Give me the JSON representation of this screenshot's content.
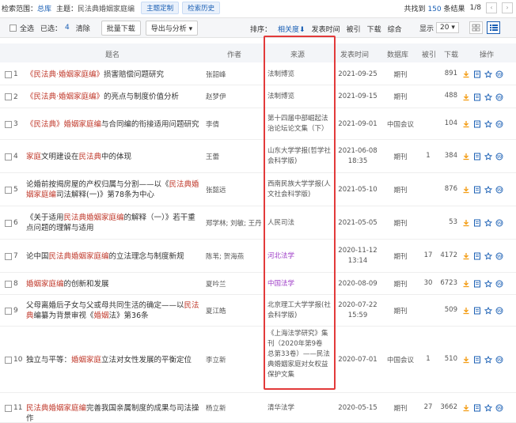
{
  "topbar": {
    "scope_label": "检索范围：",
    "scope_value": "总库",
    "theme_label": "主题：",
    "theme_value": "民法典婚姻家庭编",
    "btn_custom": "主题定制",
    "btn_history": "检索历史",
    "total_prefix": "共找到",
    "total_count": "150",
    "total_suffix": "条结果",
    "page": "1/8"
  },
  "toolbar": {
    "select_all": "全选",
    "selected_label": "已选：",
    "selected_count": "4",
    "clear": "清除",
    "batch_download": "批量下载",
    "export": "导出与分析 ▾",
    "sort_label": "排序：",
    "sort_relevance": "相关度⬇",
    "sort_date": "发表时间",
    "sort_cited": "被引",
    "sort_download": "下载",
    "sort_overall": "综合",
    "display_label": "显示",
    "display_value": "20 ▾"
  },
  "columns": {
    "title": "题名",
    "author": "作者",
    "source": "来源",
    "date": "发表时间",
    "db": "数据库",
    "cited": "被引",
    "download": "下载",
    "ops": "操作"
  },
  "rows": [
    {
      "num": "1",
      "title_parts": [
        {
          "t": "《民法典·婚姻家庭编》",
          "hl": true
        },
        {
          "t": "损害赔偿问题研究",
          "hl": false
        }
      ],
      "author": "张韶峰",
      "source": "法制博览",
      "date": "2021-09-25",
      "db": "期刊",
      "cited": "",
      "download": "891",
      "purple": false
    },
    {
      "num": "2",
      "title_parts": [
        {
          "t": "《民法典·婚姻家庭编》",
          "hl": true
        },
        {
          "t": "的亮点与制度价值分析",
          "hl": false
        }
      ],
      "author": "赵梦伊",
      "source": "法制博览",
      "date": "2021-09-15",
      "db": "期刊",
      "cited": "",
      "download": "488",
      "purple": false
    },
    {
      "num": "3",
      "title_parts": [
        {
          "t": "《民法典》",
          "hl": true
        },
        {
          "t": "婚姻家庭编",
          "hl": true
        },
        {
          "t": "与合同编的衔接适用问题研究",
          "hl": false
        }
      ],
      "author": "李倩",
      "source": "第十四届中部崛起法治论坛论文集（下）",
      "date": "2021-09-01",
      "db": "中国会议",
      "cited": "",
      "download": "104",
      "purple": false
    },
    {
      "num": "4",
      "title_parts": [
        {
          "t": "家庭",
          "hl": true
        },
        {
          "t": "文明建设在",
          "hl": false
        },
        {
          "t": "民法典",
          "hl": true
        },
        {
          "t": "中的体现",
          "hl": false
        }
      ],
      "author": "王蕾",
      "source": "山东大学学报(哲学社会科学版)",
      "date": "2021-06-08 18:35",
      "db": "期刊",
      "cited": "1",
      "download": "384",
      "purple": false
    },
    {
      "num": "5",
      "title_parts": [
        {
          "t": "论婚前按揭房屋的产权归属与分割——以《",
          "hl": false
        },
        {
          "t": "民法典婚姻家庭编",
          "hl": true
        },
        {
          "t": "司法解释(一)》第78条为中心",
          "hl": false
        }
      ],
      "author": "张懿远",
      "source": "西南民族大学学报(人文社会科学版)",
      "date": "2021-05-10",
      "db": "期刊",
      "cited": "",
      "download": "876",
      "purple": false
    },
    {
      "num": "6",
      "title_parts": [
        {
          "t": "《关于适用",
          "hl": false
        },
        {
          "t": "民法典婚姻家庭编",
          "hl": true
        },
        {
          "t": "的解释（一）》若干重点问题的理解与适用",
          "hl": false
        }
      ],
      "author": "郑学林; 刘敏; 王丹",
      "source": "人民司法",
      "date": "2021-05-05",
      "db": "期刊",
      "cited": "",
      "download": "53",
      "purple": false
    },
    {
      "num": "7",
      "title_parts": [
        {
          "t": "论中国",
          "hl": false
        },
        {
          "t": "民法典婚姻家庭编",
          "hl": true
        },
        {
          "t": "的立法理念与制度新规",
          "hl": false
        }
      ],
      "author": "陈苇; 贺海燕",
      "source": "河北法学",
      "date": "2020-11-12 13:14",
      "db": "期刊",
      "cited": "17",
      "download": "4172",
      "purple": true
    },
    {
      "num": "8",
      "title_parts": [
        {
          "t": "婚姻家庭编",
          "hl": true
        },
        {
          "t": "的创新和发展",
          "hl": false
        }
      ],
      "author": "夏吟兰",
      "source": "中国法学",
      "date": "2020-08-09",
      "db": "期刊",
      "cited": "30",
      "download": "6723",
      "purple": true
    },
    {
      "num": "9",
      "title_parts": [
        {
          "t": "父母离婚后子女与父或母共同生活的确定——以",
          "hl": false
        },
        {
          "t": "民法典",
          "hl": true
        },
        {
          "t": "编纂为背景审视《",
          "hl": false
        },
        {
          "t": "婚姻",
          "hl": true
        },
        {
          "t": "法》第36条",
          "hl": false
        }
      ],
      "author": "夏江皓",
      "source": "北京理工大学学报(社会科学版)",
      "date": "2020-07-22 15:59",
      "db": "期刊",
      "cited": "",
      "download": "509",
      "purple": false
    },
    {
      "num": "10",
      "title_parts": [
        {
          "t": "独立与平等：",
          "hl": false
        },
        {
          "t": "婚姻家庭",
          "hl": true
        },
        {
          "t": "立法对女性发展的平衡定位",
          "hl": false
        }
      ],
      "author": "李立新",
      "source": "《上海法学研究》集刊（2020年第9卷 总第33卷）——民法典婚姻家庭对女权益保护文集",
      "date": "2020-07-01",
      "db": "中国会议",
      "cited": "1",
      "download": "510",
      "purple": false
    },
    {
      "num": "11",
      "title_parts": [
        {
          "t": "民法典婚姻家庭编",
          "hl": true
        },
        {
          "t": "完善我国亲属制度的成果与司法操作",
          "hl": false
        }
      ],
      "author": "杨立新",
      "source": "清华法学",
      "date": "2020-05-15",
      "db": "期刊",
      "cited": "27",
      "download": "3662",
      "purple": false
    }
  ],
  "icons": [
    "download-icon",
    "read-icon",
    "favorite-icon",
    "cite-icon"
  ],
  "colors": {
    "accent": "#1a5fb4",
    "highlight": "#c0392b",
    "purple": "#a040c8",
    "redbox": "#e23a3a"
  }
}
